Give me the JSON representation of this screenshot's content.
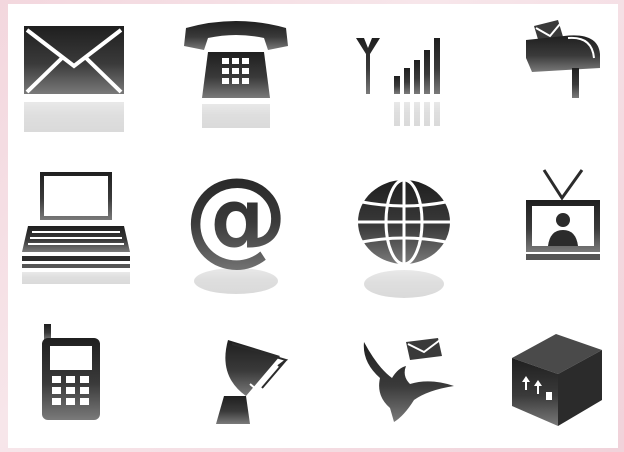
{
  "canvas": {
    "background": "#ffffff",
    "page_tint": "#f3d7de"
  },
  "colors": {
    "icon_dark": "#2b2b2b",
    "icon_light": "#8a8a8a"
  },
  "icons": [
    {
      "name": "envelope-icon"
    },
    {
      "name": "telephone-icon"
    },
    {
      "name": "signal-strength-icon"
    },
    {
      "name": "mailbox-icon"
    },
    {
      "name": "laptop-icon"
    },
    {
      "name": "at-sign-icon"
    },
    {
      "name": "globe-icon"
    },
    {
      "name": "television-icon"
    },
    {
      "name": "mobile-phone-icon"
    },
    {
      "name": "satellite-dish-icon"
    },
    {
      "name": "dove-with-letter-icon"
    },
    {
      "name": "package-box-icon"
    }
  ]
}
